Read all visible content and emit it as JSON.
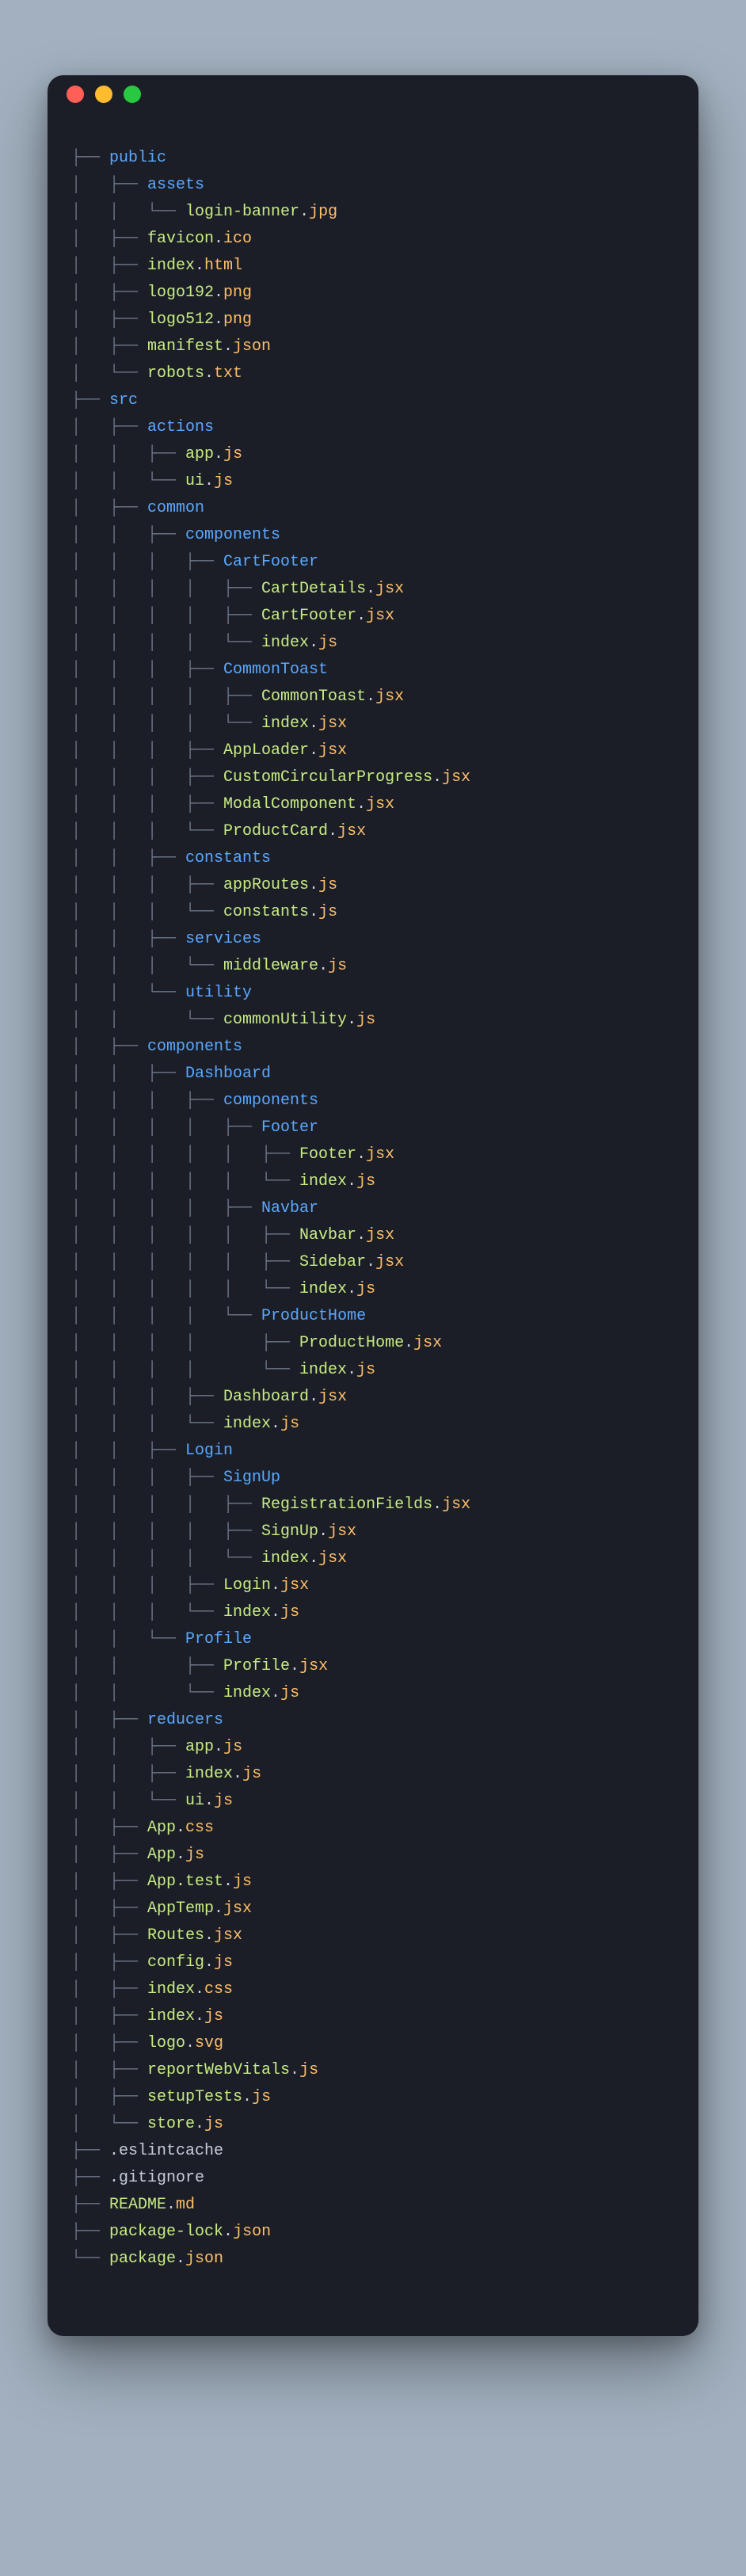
{
  "window": {
    "buttons": [
      "close",
      "minimize",
      "maximize"
    ]
  },
  "tree": [
    {
      "prefix": "├── ",
      "kind": "dir",
      "name": "public"
    },
    {
      "prefix": "│   ├── ",
      "kind": "dir",
      "name": "assets"
    },
    {
      "prefix": "│   │   └── ",
      "kind": "file",
      "stem": "login-banner",
      "ext": "jpg"
    },
    {
      "prefix": "│   ├── ",
      "kind": "file",
      "stem": "favicon",
      "ext": "ico"
    },
    {
      "prefix": "│   ├── ",
      "kind": "file",
      "stem": "index",
      "ext": "html"
    },
    {
      "prefix": "│   ├── ",
      "kind": "file",
      "stem": "logo192",
      "ext": "png"
    },
    {
      "prefix": "│   ├── ",
      "kind": "file",
      "stem": "logo512",
      "ext": "png"
    },
    {
      "prefix": "│   ├── ",
      "kind": "file",
      "stem": "manifest",
      "ext": "json"
    },
    {
      "prefix": "│   └── ",
      "kind": "file",
      "stem": "robots",
      "ext": "txt"
    },
    {
      "prefix": "├── ",
      "kind": "dir",
      "name": "src"
    },
    {
      "prefix": "│   ├── ",
      "kind": "dir",
      "name": "actions"
    },
    {
      "prefix": "│   │   ├── ",
      "kind": "file",
      "stem": "app",
      "ext": "js"
    },
    {
      "prefix": "│   │   └── ",
      "kind": "file",
      "stem": "ui",
      "ext": "js"
    },
    {
      "prefix": "│   ├── ",
      "kind": "dir",
      "name": "common"
    },
    {
      "prefix": "│   │   ├── ",
      "kind": "dir",
      "name": "components"
    },
    {
      "prefix": "│   │   │   ├── ",
      "kind": "dir",
      "name": "CartFooter"
    },
    {
      "prefix": "│   │   │   │   ├── ",
      "kind": "file",
      "stem": "CartDetails",
      "ext": "jsx"
    },
    {
      "prefix": "│   │   │   │   ├── ",
      "kind": "file",
      "stem": "CartFooter",
      "ext": "jsx"
    },
    {
      "prefix": "│   │   │   │   └── ",
      "kind": "file",
      "stem": "index",
      "ext": "js"
    },
    {
      "prefix": "│   │   │   ├── ",
      "kind": "dir",
      "name": "CommonToast"
    },
    {
      "prefix": "│   │   │   │   ├── ",
      "kind": "file",
      "stem": "CommonToast",
      "ext": "jsx"
    },
    {
      "prefix": "│   │   │   │   └── ",
      "kind": "file",
      "stem": "index",
      "ext": "jsx"
    },
    {
      "prefix": "│   │   │   ├── ",
      "kind": "file",
      "stem": "AppLoader",
      "ext": "jsx"
    },
    {
      "prefix": "│   │   │   ├── ",
      "kind": "file",
      "stem": "CustomCircularProgress",
      "ext": "jsx"
    },
    {
      "prefix": "│   │   │   ├── ",
      "kind": "file",
      "stem": "ModalComponent",
      "ext": "jsx"
    },
    {
      "prefix": "│   │   │   └── ",
      "kind": "file",
      "stem": "ProductCard",
      "ext": "jsx"
    },
    {
      "prefix": "│   │   ├── ",
      "kind": "dir",
      "name": "constants"
    },
    {
      "prefix": "│   │   │   ├── ",
      "kind": "file",
      "stem": "appRoutes",
      "ext": "js"
    },
    {
      "prefix": "│   │   │   └── ",
      "kind": "file",
      "stem": "constants",
      "ext": "js"
    },
    {
      "prefix": "│   │   ├── ",
      "kind": "dir",
      "name": "services"
    },
    {
      "prefix": "│   │   │   └── ",
      "kind": "file",
      "stem": "middleware",
      "ext": "js"
    },
    {
      "prefix": "│   │   └── ",
      "kind": "dir",
      "name": "utility"
    },
    {
      "prefix": "│   │       └── ",
      "kind": "file",
      "stem": "commonUtility",
      "ext": "js"
    },
    {
      "prefix": "│   ├── ",
      "kind": "dir",
      "name": "components"
    },
    {
      "prefix": "│   │   ├── ",
      "kind": "dir",
      "name": "Dashboard"
    },
    {
      "prefix": "│   │   │   ├── ",
      "kind": "dir",
      "name": "components"
    },
    {
      "prefix": "│   │   │   │   ├── ",
      "kind": "dir",
      "name": "Footer"
    },
    {
      "prefix": "│   │   │   │   │   ├── ",
      "kind": "file",
      "stem": "Footer",
      "ext": "jsx"
    },
    {
      "prefix": "│   │   │   │   │   └── ",
      "kind": "file",
      "stem": "index",
      "ext": "js"
    },
    {
      "prefix": "│   │   │   │   ├── ",
      "kind": "dir",
      "name": "Navbar"
    },
    {
      "prefix": "│   │   │   │   │   ├── ",
      "kind": "file",
      "stem": "Navbar",
      "ext": "jsx"
    },
    {
      "prefix": "│   │   │   │   │   ├── ",
      "kind": "file",
      "stem": "Sidebar",
      "ext": "jsx"
    },
    {
      "prefix": "│   │   │   │   │   └── ",
      "kind": "file",
      "stem": "index",
      "ext": "js"
    },
    {
      "prefix": "│   │   │   │   └── ",
      "kind": "dir",
      "name": "ProductHome"
    },
    {
      "prefix": "│   │   │   │       ├── ",
      "kind": "file",
      "stem": "ProductHome",
      "ext": "jsx"
    },
    {
      "prefix": "│   │   │   │       └── ",
      "kind": "file",
      "stem": "index",
      "ext": "js"
    },
    {
      "prefix": "│   │   │   ├── ",
      "kind": "file",
      "stem": "Dashboard",
      "ext": "jsx"
    },
    {
      "prefix": "│   │   │   └── ",
      "kind": "file",
      "stem": "index",
      "ext": "js"
    },
    {
      "prefix": "│   │   ├── ",
      "kind": "dir",
      "name": "Login"
    },
    {
      "prefix": "│   │   │   ├── ",
      "kind": "dir",
      "name": "SignUp"
    },
    {
      "prefix": "│   │   │   │   ├── ",
      "kind": "file",
      "stem": "RegistrationFields",
      "ext": "jsx"
    },
    {
      "prefix": "│   │   │   │   ├── ",
      "kind": "file",
      "stem": "SignUp",
      "ext": "jsx"
    },
    {
      "prefix": "│   │   │   │   └── ",
      "kind": "file",
      "stem": "index",
      "ext": "jsx"
    },
    {
      "prefix": "│   │   │   ├── ",
      "kind": "file",
      "stem": "Login",
      "ext": "jsx"
    },
    {
      "prefix": "│   │   │   └── ",
      "kind": "file",
      "stem": "index",
      "ext": "js"
    },
    {
      "prefix": "│   │   └── ",
      "kind": "dir",
      "name": "Profile"
    },
    {
      "prefix": "│   │       ├── ",
      "kind": "file",
      "stem": "Profile",
      "ext": "jsx"
    },
    {
      "prefix": "│   │       └── ",
      "kind": "file",
      "stem": "index",
      "ext": "js"
    },
    {
      "prefix": "│   ├── ",
      "kind": "dir",
      "name": "reducers"
    },
    {
      "prefix": "│   │   ├── ",
      "kind": "file",
      "stem": "app",
      "ext": "js"
    },
    {
      "prefix": "│   │   ├── ",
      "kind": "file",
      "stem": "index",
      "ext": "js"
    },
    {
      "prefix": "│   │   └── ",
      "kind": "file",
      "stem": "ui",
      "ext": "js"
    },
    {
      "prefix": "│   ├── ",
      "kind": "file",
      "stem": "App",
      "ext": "css"
    },
    {
      "prefix": "│   ├── ",
      "kind": "file",
      "stem": "App",
      "ext": "js"
    },
    {
      "prefix": "│   ├── ",
      "kind": "file",
      "stem": "App.test",
      "ext": "js"
    },
    {
      "prefix": "│   ├── ",
      "kind": "file",
      "stem": "AppTemp",
      "ext": "jsx"
    },
    {
      "prefix": "│   ├── ",
      "kind": "file",
      "stem": "Routes",
      "ext": "jsx"
    },
    {
      "prefix": "│   ├── ",
      "kind": "file",
      "stem": "config",
      "ext": "js"
    },
    {
      "prefix": "│   ├── ",
      "kind": "file",
      "stem": "index",
      "ext": "css"
    },
    {
      "prefix": "│   ├── ",
      "kind": "file",
      "stem": "index",
      "ext": "js"
    },
    {
      "prefix": "│   ├── ",
      "kind": "file",
      "stem": "logo",
      "ext": "svg"
    },
    {
      "prefix": "│   ├── ",
      "kind": "file",
      "stem": "reportWebVitals",
      "ext": "js"
    },
    {
      "prefix": "│   ├── ",
      "kind": "file",
      "stem": "setupTests",
      "ext": "js"
    },
    {
      "prefix": "│   └── ",
      "kind": "file",
      "stem": "store",
      "ext": "js"
    },
    {
      "prefix": "├── ",
      "kind": "plain",
      "name": ".eslintcache"
    },
    {
      "prefix": "├── ",
      "kind": "plain",
      "name": ".gitignore"
    },
    {
      "prefix": "├── ",
      "kind": "file",
      "stem": "README",
      "ext": "md"
    },
    {
      "prefix": "├── ",
      "kind": "file",
      "stem": "package-lock",
      "ext": "json"
    },
    {
      "prefix": "└── ",
      "kind": "file",
      "stem": "package",
      "ext": "json"
    }
  ]
}
